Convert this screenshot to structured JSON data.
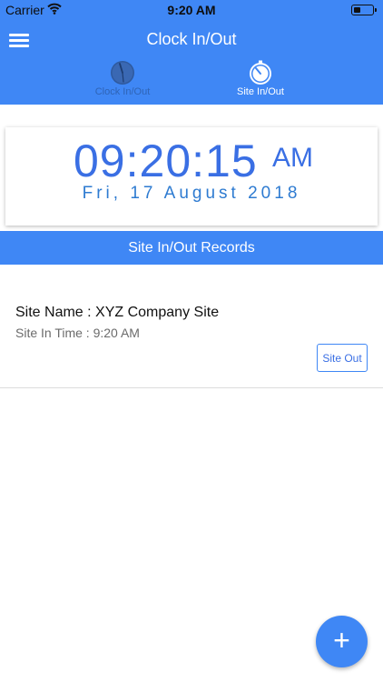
{
  "status_bar": {
    "carrier": "Carrier",
    "time": "9:20 AM",
    "battery_level_fraction": 0.25
  },
  "header": {
    "title": "Clock In/Out",
    "tabs": [
      {
        "label": "Clock In/Out",
        "icon": "clock-icon",
        "active": false
      },
      {
        "label": "Site In/Out",
        "icon": "stopwatch-icon",
        "active": true
      }
    ]
  },
  "clock": {
    "time": "09:20:15",
    "ampm": "AM",
    "date": "Fri, 17 August 2018"
  },
  "records": {
    "header": "Site In/Out Records",
    "items": [
      {
        "site_name": "Site Name : XYZ Company Site",
        "site_in_time": "Site In Time : 9:20 AM",
        "action_label": "Site Out"
      }
    ]
  },
  "fab": {
    "icon": "plus-icon",
    "label": "+"
  },
  "colors": {
    "primary": "#3f87f5",
    "accent_text": "#3a6fe4",
    "date_text": "#2e7bd1"
  }
}
